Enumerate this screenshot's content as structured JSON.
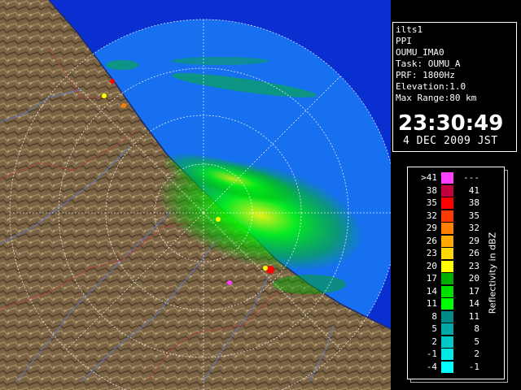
{
  "info": {
    "lines": [
      "ilts1",
      "PPI",
      "OUMU_IMA0",
      "Task: OUMU_A",
      "PRF: 1800Hz",
      "Elevation:1.0",
      "Max Range:80 km"
    ],
    "time": "23:30:49",
    "date": "4 DEC 2009 JST"
  },
  "legend": {
    "unit": "Reflectivity in dBZ",
    "rows": [
      {
        "lo": ">41",
        "hi": "---",
        "color": "#ff40ff"
      },
      {
        "lo": "38",
        "hi": "41",
        "color": "#c0003a"
      },
      {
        "lo": "35",
        "hi": "38",
        "color": "#ff0000"
      },
      {
        "lo": "32",
        "hi": "35",
        "color": "#ff3a00"
      },
      {
        "lo": "29",
        "hi": "32",
        "color": "#ff8000"
      },
      {
        "lo": "26",
        "hi": "29",
        "color": "#ffa800"
      },
      {
        "lo": "23",
        "hi": "26",
        "color": "#ffd800"
      },
      {
        "lo": "20",
        "hi": "23",
        "color": "#ffff00"
      },
      {
        "lo": "17",
        "hi": "20",
        "color": "#00b000"
      },
      {
        "lo": "14",
        "hi": "17",
        "color": "#00e000"
      },
      {
        "lo": "11",
        "hi": "14",
        "color": "#00ff00"
      },
      {
        "lo": "8",
        "hi": "11",
        "color": "#008a8a"
      },
      {
        "lo": "5",
        "hi": "8",
        "color": "#00a8a8"
      },
      {
        "lo": "2",
        "hi": "5",
        "color": "#00c8c8"
      },
      {
        "lo": "-1",
        "hi": "2",
        "color": "#00e8e8"
      },
      {
        "lo": "-4",
        "hi": "-1",
        "color": "#00ffff"
      }
    ]
  },
  "colors": {
    "land": "#7a6445",
    "sea": "#0a2fd0",
    "radar_disc": "#1670f0",
    "range_ring": "#ffffff"
  }
}
